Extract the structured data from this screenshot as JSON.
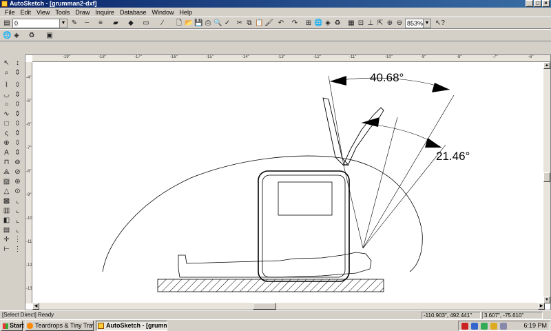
{
  "window": {
    "title": "AutoSketch - [grumman2-dxf]"
  },
  "menu": [
    "File",
    "Edit",
    "View",
    "Tools",
    "Draw",
    "Inquire",
    "Database",
    "Window",
    "Help"
  ],
  "toolbar": {
    "layer_value": "0",
    "zoom_value": "853%"
  },
  "ruler_h_labels": [
    "-19\"",
    "-18\"",
    "-17\"",
    "-16\"",
    "-15\"",
    "-14\"",
    "-13\"",
    "-12\"",
    "-11\"",
    "-10\"",
    "-9\"",
    "-8\"",
    "-7\"",
    "-6\""
  ],
  "ruler_v_labels": [
    "-4\"",
    "-5\"",
    "-6\"",
    "-7\"",
    "-8\"",
    "-9\"",
    "-10\"",
    "-11\"",
    "-12\"",
    "-13\""
  ],
  "drawing": {
    "angle1": "40.68°",
    "angle2": "21.46°"
  },
  "status": {
    "mode": "[Select Direct] Ready",
    "coords": "-110.903\", 492.441\"",
    "delta": "3.607\", -75.610\""
  },
  "taskbar": {
    "start_label": "Start",
    "items": [
      "Teardrops & Tiny Travel ...",
      "AutoSketch - [grumm..."
    ],
    "clock": "6:19 PM"
  },
  "colors": {
    "title_start": "#0a246a",
    "title_end": "#3a6ea5"
  }
}
